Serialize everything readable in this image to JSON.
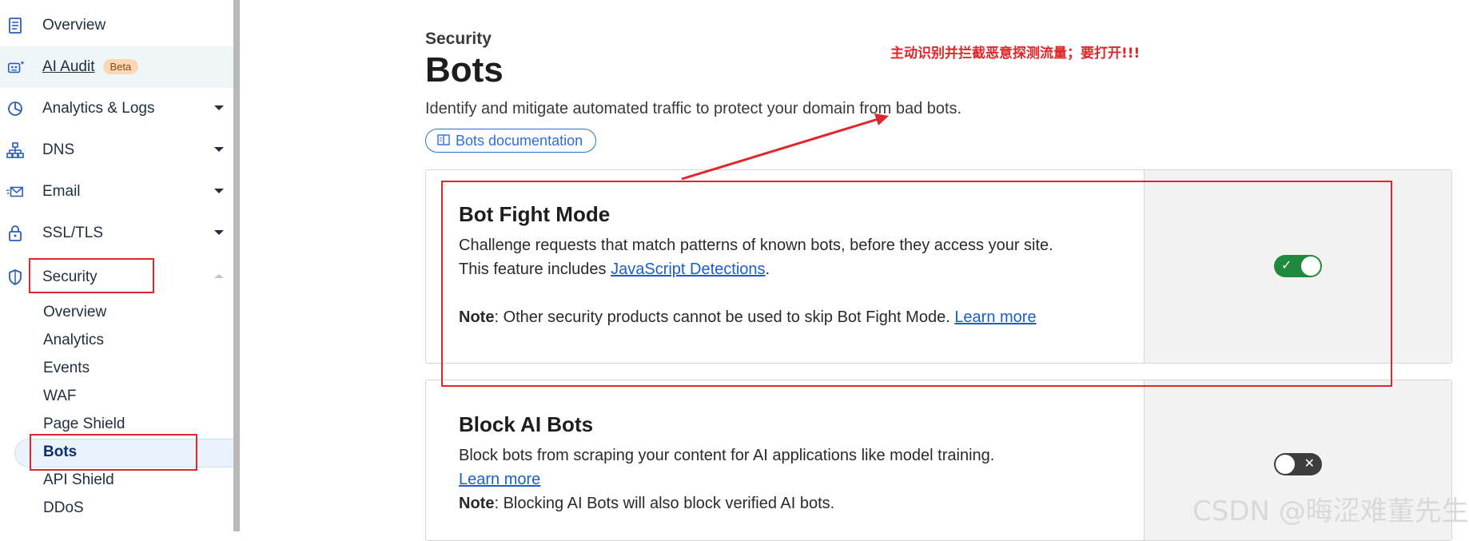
{
  "sidebar": {
    "items": [
      {
        "label": "Overview",
        "icon": "document-icon",
        "has_caret": false
      },
      {
        "label": "AI Audit",
        "icon": "robot-icon",
        "badge": "Beta"
      },
      {
        "label": "Analytics & Logs",
        "icon": "pie-chart-icon",
        "has_caret": true
      },
      {
        "label": "DNS",
        "icon": "network-icon",
        "has_caret": true
      },
      {
        "label": "Email",
        "icon": "email-icon",
        "has_caret": true
      },
      {
        "label": "SSL/TLS",
        "icon": "lock-icon",
        "has_caret": true
      },
      {
        "label": "Security",
        "icon": "shield-icon",
        "expanded": true
      }
    ],
    "security_subitems": [
      "Overview",
      "Analytics",
      "Events",
      "WAF",
      "Page Shield",
      "Bots",
      "API Shield",
      "DDoS"
    ],
    "active_subitem": "Bots"
  },
  "page": {
    "kicker": "Security",
    "title": "Bots",
    "subtitle": "Identify and mitigate automated traffic to protect your domain from bad bots.",
    "doc_button": "Bots documentation"
  },
  "cards": {
    "bot_fight": {
      "title": "Bot Fight Mode",
      "line1": "Challenge requests that match patterns of known bots, before they access your site.",
      "line2_prefix": "This feature includes ",
      "line2_link": "JavaScript Detections",
      "line2_suffix": ".",
      "note_label": "Note",
      "note_text": ": Other security products cannot be used to skip Bot Fight Mode. ",
      "note_link": "Learn more",
      "toggle_state": "on"
    },
    "block_ai": {
      "title": "Block AI Bots",
      "line1": "Block bots from scraping your content for AI applications like model training.",
      "learn_more": "Learn more",
      "note_label": "Note",
      "note_text": ": Blocking AI Bots will also block verified AI bots.",
      "toggle_state": "off"
    }
  },
  "annotation": "主动识别并拦截恶意探测流量；要打开!!!",
  "watermark": "CSDN @晦涩难董先生",
  "colors": {
    "accent": "#2f6fd1",
    "toggle_on": "#1f8a3e",
    "toggle_off": "#3d3d3d",
    "annotation": "#e0262a"
  }
}
